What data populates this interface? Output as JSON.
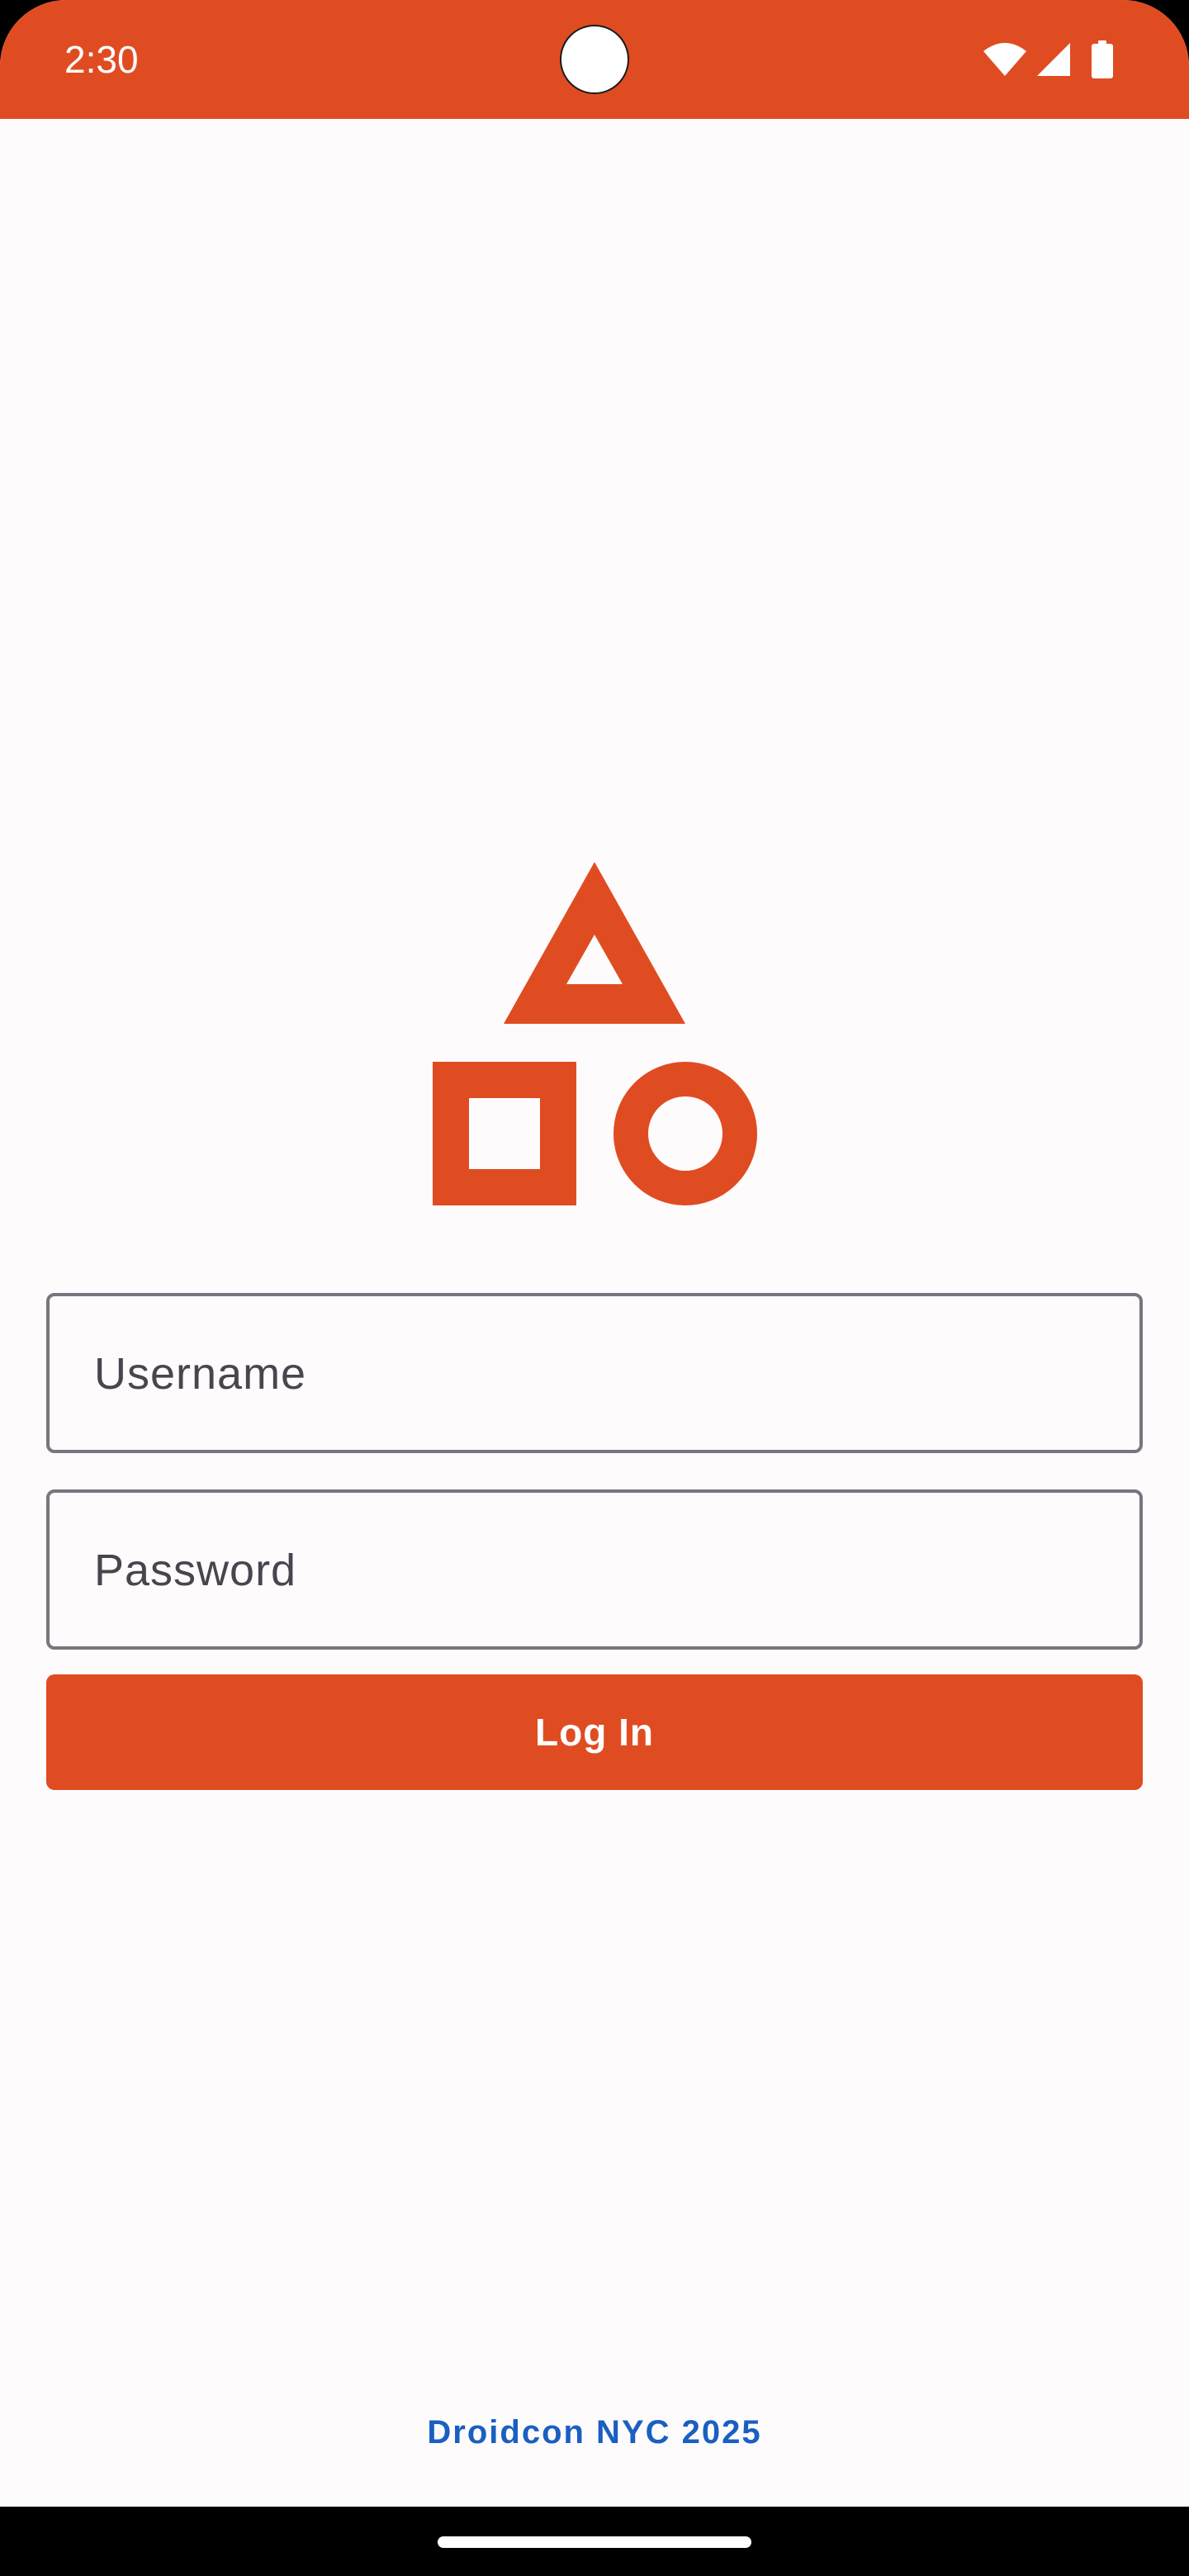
{
  "status_bar": {
    "time": "2:30",
    "background_color": "#E04C22",
    "icons": [
      "wifi-icon",
      "cellular-signal-icon",
      "battery-icon"
    ]
  },
  "logo": {
    "icon": "shapes-logo-icon",
    "color": "#E04C22"
  },
  "login_form": {
    "username_placeholder": "Username",
    "password_placeholder": "Password",
    "login_button_label": "Log In",
    "accent_color": "#E04C22",
    "field_border_color": "#79747E"
  },
  "footer": {
    "text": "Droidcon NYC 2025",
    "color": "#1A5FC2"
  }
}
